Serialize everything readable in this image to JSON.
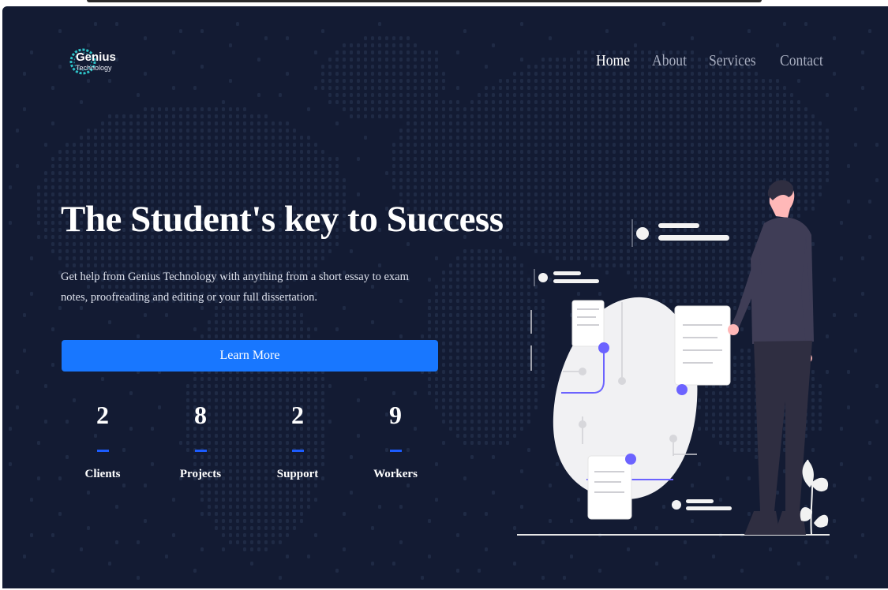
{
  "brand": {
    "name": "Genius",
    "sub": "Technology"
  },
  "nav": [
    {
      "label": "Home",
      "active": true
    },
    {
      "label": "About",
      "active": false
    },
    {
      "label": "Services",
      "active": false
    },
    {
      "label": "Contact",
      "active": false
    }
  ],
  "hero": {
    "headline": "The Student's key to Success",
    "description": "Get help from Genius Technology with anything from a short essay to exam notes, proofreading and editing or your full dissertation.",
    "cta": "Learn More"
  },
  "stats": [
    {
      "value": "2",
      "label": "Clients"
    },
    {
      "value": "8",
      "label": "Projects"
    },
    {
      "value": "2",
      "label": "Support"
    },
    {
      "value": "9",
      "label": "Workers"
    }
  ],
  "colors": {
    "background": "#131b33",
    "accent": "#1877ff",
    "dot": "#6c63ff"
  }
}
